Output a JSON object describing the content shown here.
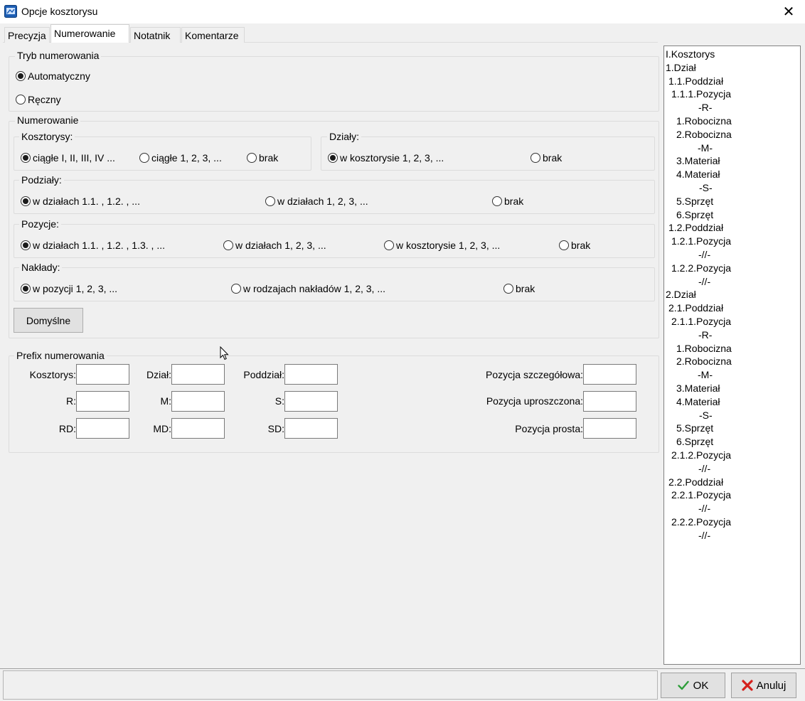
{
  "window": {
    "title": "Opcje kosztorysu",
    "close_glyph": "✕"
  },
  "tabs": [
    {
      "label": "Precyzja"
    },
    {
      "label": "Numerowanie"
    },
    {
      "label": "Notatnik"
    },
    {
      "label": "Komentarze"
    }
  ],
  "mode_group": {
    "label": "Tryb numerowania",
    "options": [
      {
        "label": "Automatyczny",
        "selected": true
      },
      {
        "label": "Ręczny",
        "selected": false
      }
    ]
  },
  "numbering_group": {
    "label": "Numerowanie",
    "kosztorysy": {
      "label": "Kosztorysy:",
      "options": [
        {
          "label": "ciągłe I, II, III, IV ...",
          "selected": true
        },
        {
          "label": "ciągłe 1, 2, 3, ...",
          "selected": false
        },
        {
          "label": "brak",
          "selected": false
        }
      ]
    },
    "dzialy": {
      "label": "Działy:",
      "options": [
        {
          "label": "w kosztorysie 1, 2, 3, ...",
          "selected": true
        },
        {
          "label": "brak",
          "selected": false
        }
      ]
    },
    "poddzialy": {
      "label": "Podziały:",
      "options": [
        {
          "label": "w działach 1.1. , 1.2. , ...",
          "selected": true
        },
        {
          "label": "w działach 1, 2, 3, ...",
          "selected": false
        },
        {
          "label": "brak",
          "selected": false
        }
      ]
    },
    "pozycje": {
      "label": "Pozycje:",
      "options": [
        {
          "label": "w działach 1.1. , 1.2. , 1.3. , ...",
          "selected": true
        },
        {
          "label": "w działach 1, 2, 3, ...",
          "selected": false
        },
        {
          "label": "w kosztorysie 1, 2, 3, ...",
          "selected": false
        },
        {
          "label": "brak",
          "selected": false
        }
      ]
    },
    "naklady": {
      "label": "Nakłady:",
      "options": [
        {
          "label": "w pozycji 1, 2, 3, ...",
          "selected": true
        },
        {
          "label": "w rodzajach nakładów 1, 2, 3, ...",
          "selected": false
        },
        {
          "label": "brak",
          "selected": false
        }
      ]
    },
    "default_button": "Domyślne"
  },
  "prefix_group": {
    "label": "Prefix numerowania",
    "fields": {
      "kosztorys": {
        "label": "Kosztorys:",
        "value": ""
      },
      "dzial": {
        "label": "Dział:",
        "value": ""
      },
      "poddzial": {
        "label": "Poddział:",
        "value": ""
      },
      "r": {
        "label": "R:",
        "value": ""
      },
      "m": {
        "label": "M:",
        "value": ""
      },
      "s": {
        "label": "S:",
        "value": ""
      },
      "rd": {
        "label": "RD:",
        "value": ""
      },
      "md": {
        "label": "MD:",
        "value": ""
      },
      "sd": {
        "label": "SD:",
        "value": ""
      },
      "poz_szczegolowa": {
        "label": "Pozycja szczegółowa:",
        "value": ""
      },
      "poz_uproszczona": {
        "label": "Pozycja uproszczona:",
        "value": ""
      },
      "poz_prosta": {
        "label": "Pozycja prosta:",
        "value": ""
      }
    }
  },
  "preview_tree": [
    "I.Kosztorys",
    "1.Dział",
    "1.1.Poddział",
    "1.1.1.Pozycja",
    "-R-",
    "1.Robocizna",
    "2.Robocizna",
    "-M-",
    "3.Materiał",
    "4.Materiał",
    "-S-",
    "5.Sprzęt",
    "6.Sprzęt",
    "1.2.Poddział",
    "1.2.1.Pozycja",
    "-//-",
    "1.2.2.Pozycja",
    "-//-",
    "2.Dział",
    "2.1.Poddział",
    "2.1.1.Pozycja",
    "-R-",
    "1.Robocizna",
    "2.Robocizna",
    "-M-",
    "3.Materiał",
    "4.Materiał",
    "-S-",
    "5.Sprzęt",
    "6.Sprzęt",
    "2.1.2.Pozycja",
    "-//-",
    "2.2.Poddział",
    "2.2.1.Pozycja",
    "-//-",
    "2.2.2.Pozycja",
    "-//-"
  ],
  "footer": {
    "ok_label": "OK",
    "cancel_label": "Anuluj"
  }
}
